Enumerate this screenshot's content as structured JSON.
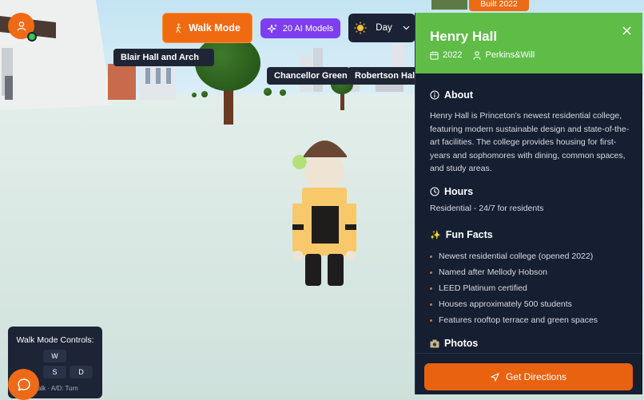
{
  "toolbar": {
    "walk_mode_label": "Walk Mode",
    "ai_models_label": "20 AI Models",
    "time_label": "Day"
  },
  "map_labels": {
    "blair": "Blair Hall and Arch",
    "chancellor": "Chancellor Green L",
    "robertson": "Robertson Hall"
  },
  "badge": {
    "built": "Built 2022"
  },
  "panel": {
    "title": "Henry Hall",
    "year": "2022",
    "architect": "Perkins&Will",
    "about_heading": "About",
    "about_text": "Henry Hall is Princeton's newest residential college, featuring modern sustainable design and state-of-the-art facilities. The college provides housing for first-years and sophomores with dining, common spaces, and study areas.",
    "hours_heading": "Hours",
    "hours_text": "Residential - 24/7 for residents",
    "fun_facts_heading": "Fun Facts",
    "fun_facts": [
      "Newest residential college (opened 2022)",
      "Named after Mellody Hobson",
      "LEED Platinum certified",
      "Houses approximately 500 students",
      "Features rooftop terrace and green spaces"
    ],
    "photos_heading": "Photos",
    "directions_label": "Get Directions"
  },
  "controls": {
    "title": "Walk Mode Controls:",
    "keys": [
      "W",
      "S",
      "D"
    ],
    "hint": "alk · A/D: Turn"
  },
  "colors": {
    "accent": "#ee6a16",
    "header_green": "#5fbd47",
    "panel_bg": "#161e31",
    "ai_purple": "#7d3ef0"
  },
  "icons": {
    "avatar": "user-icon",
    "walk": "walking-person-icon",
    "ai": "sparkles-icon",
    "day": "sun-icon",
    "chevron": "chevron-down-icon",
    "close": "close-icon",
    "calendar": "calendar-icon",
    "person": "person-icon",
    "info": "info-icon",
    "clock": "clock-icon",
    "fun_facts": "sparkles-emoji-icon",
    "photos": "camera-icon",
    "directions": "navigation-arrow-icon",
    "chat": "chat-bubble-icon"
  }
}
